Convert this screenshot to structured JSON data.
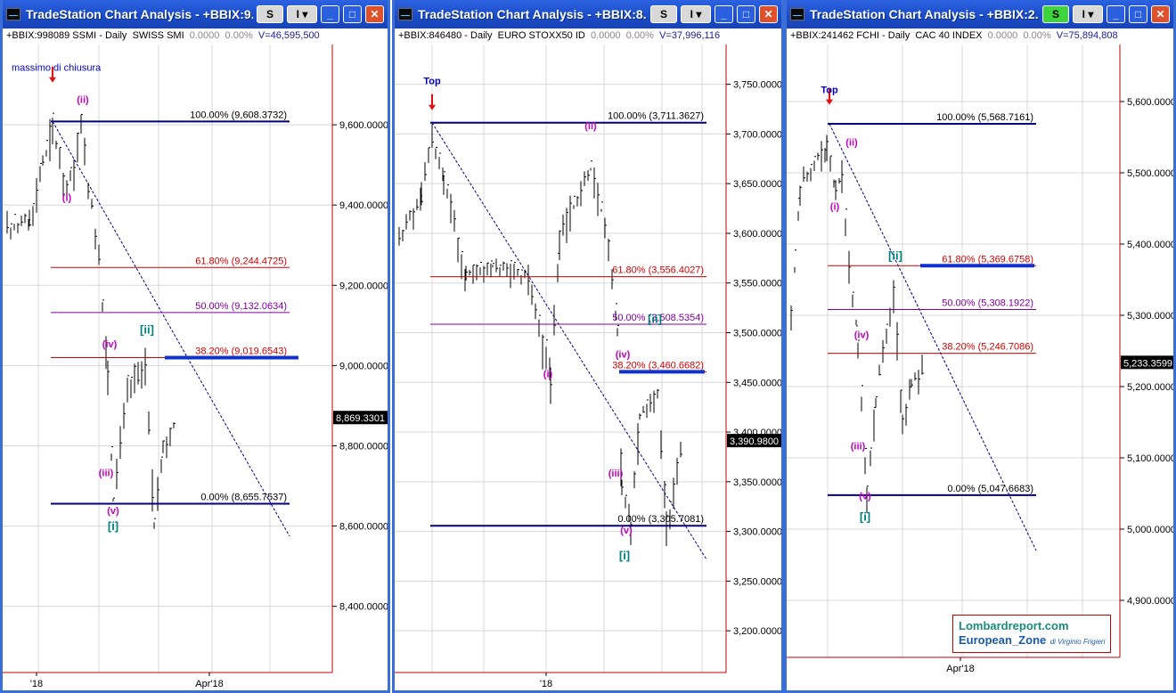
{
  "windows": [
    {
      "title": "TradeStation Chart Analysis - +BBIX:9...",
      "info": {
        "symbol": "+BBIX:998089 SSMI - Daily",
        "name": "SWISS SMI",
        "change": "0.0000",
        "pct": "0.00%",
        "volume": "V=46,595,500"
      },
      "s_label": "S",
      "controls": {
        "mode": "I",
        "minimize": "_",
        "maximize": "□",
        "close": "✕"
      }
    },
    {
      "title": "TradeStation Chart Analysis - +BBIX:8...",
      "info": {
        "symbol": "+BBIX:846480 - Daily",
        "name": "EURO STOXX50 ID",
        "change": "0.0000",
        "pct": "0.00%",
        "volume": "V=37,996,116"
      },
      "s_label": "S",
      "controls": {
        "mode": "I",
        "minimize": "_",
        "maximize": "□",
        "close": "✕"
      }
    },
    {
      "title": "TradeStation Chart Analysis - +BBIX:2...",
      "info": {
        "symbol": "+BBIX:241462 FCHI - Daily",
        "name": "CAC 40 INDEX",
        "change": "0.0000",
        "pct": "0.00%",
        "volume": "V=75,894,808"
      },
      "s_label": "S",
      "controls": {
        "mode": "I",
        "minimize": "_",
        "maximize": "□",
        "close": "✕"
      }
    }
  ],
  "chart_data": [
    {
      "type": "ohlc-bar",
      "yticks": [
        "8,400.0000",
        "8,600.0000",
        "8,800.0000",
        "9,000.0000",
        "9,200.0000",
        "9,400.0000",
        "9,600.0000"
      ],
      "ylim": [
        8235,
        9800
      ],
      "xticks": [
        "'18",
        "Apr'18"
      ],
      "last_price": "8,869.3301",
      "fib_levels": [
        {
          "label": "100.00% (9,608.3732)",
          "value": 9608.3732,
          "color": "#000080",
          "thick": true
        },
        {
          "label": "61.80% (9,244.4725)",
          "value": 9244.4725,
          "color": "#d00000"
        },
        {
          "label": "50.00% (9,132.0634)",
          "value": 9132.0634,
          "color": "#8000a0"
        },
        {
          "label": "38.20% (9,019.6543)",
          "value": 9019.6543,
          "color": "#d00000"
        },
        {
          "label": "0.00% (8,655.7537)",
          "value": 8655.7537,
          "color": "#000080",
          "thick": true
        }
      ],
      "annotations": [
        {
          "text": "massimo di chiusura",
          "color": "#0000c0"
        },
        {
          "text": "(ii)",
          "color": "#c000c0"
        },
        {
          "text": "(i)",
          "color": "#c000c0"
        },
        {
          "text": "[ii]",
          "color": "#008080"
        },
        {
          "text": "(iv)",
          "color": "#c000c0"
        },
        {
          "text": "(iii)",
          "color": "#c000c0"
        },
        {
          "text": "(v)",
          "color": "#c000c0"
        },
        {
          "text": "[i]",
          "color": "#008080"
        }
      ]
    },
    {
      "type": "ohlc-bar",
      "yticks": [
        "3,200.0000",
        "3,250.0000",
        "3,300.0000",
        "3,350.0000",
        "3,400.0000",
        "3,450.0000",
        "3,500.0000",
        "3,550.0000",
        "3,600.0000",
        "3,650.0000",
        "3,700.0000",
        "3,750.0000"
      ],
      "ylim": [
        3158,
        3790
      ],
      "xticks": [
        "'18"
      ],
      "last_price": "3,390.9800",
      "fib_levels": [
        {
          "label": "100.00% (3,711.3627)",
          "value": 3711.3627,
          "color": "#000080",
          "thick": true
        },
        {
          "label": "61.80% (3,556.4027)",
          "value": 3556.4027,
          "color": "#d00000"
        },
        {
          "label": "50.00% (3,508.5354)",
          "value": 3508.5354,
          "color": "#8000a0"
        },
        {
          "label": "38.20% (3,460.6682)",
          "value": 3460.6682,
          "color": "#d00000"
        },
        {
          "label": "0.00% (3,305.7081)",
          "value": 3305.7081,
          "color": "#000080",
          "thick": true
        }
      ],
      "annotations": [
        {
          "text": "Top",
          "color": "#0000c0"
        },
        {
          "text": "(ii)",
          "color": "#c000c0"
        },
        {
          "text": "(i)",
          "color": "#c000c0"
        },
        {
          "text": "(iv)",
          "color": "#c000c0"
        },
        {
          "text": "[ii]",
          "color": "#008080"
        },
        {
          "text": "(iii)",
          "color": "#c000c0"
        },
        {
          "text": "(v)",
          "color": "#c000c0"
        },
        {
          "text": "[i]",
          "color": "#008080"
        }
      ]
    },
    {
      "type": "ohlc-bar",
      "yticks": [
        "4,900.0000",
        "5,000.0000",
        "5,100.0000",
        "5,200.0000",
        "5,300.0000",
        "5,400.0000",
        "5,500.0000",
        "5,600.0000"
      ],
      "ylim": [
        4820,
        5680
      ],
      "xticks": [
        "Apr'18"
      ],
      "last_price": "5,233.3599",
      "fib_levels": [
        {
          "label": "100.00% (5,568.7161)",
          "value": 5568.7161,
          "color": "#000080",
          "thick": true
        },
        {
          "label": "61.80% (5,369.6758)",
          "value": 5369.6758,
          "color": "#d00000"
        },
        {
          "label": "50.00% (5,308.1922)",
          "value": 5308.1922,
          "color": "#8000a0"
        },
        {
          "label": "38.20% (5,246.7086)",
          "value": 5246.7086,
          "color": "#d00000"
        },
        {
          "label": "0.00% (5,047.6683)",
          "value": 5047.6683,
          "color": "#000080",
          "thick": true
        }
      ],
      "annotations": [
        {
          "text": "Top",
          "color": "#0000c0"
        },
        {
          "text": "(ii)",
          "color": "#c000c0"
        },
        {
          "text": "(i)",
          "color": "#c000c0"
        },
        {
          "text": "[ii]",
          "color": "#008080"
        },
        {
          "text": "(iv)",
          "color": "#c000c0"
        },
        {
          "text": "(iii)",
          "color": "#c000c0"
        },
        {
          "text": "(v)",
          "color": "#c000c0"
        },
        {
          "text": "[i]",
          "color": "#008080"
        }
      ]
    }
  ],
  "watermark": {
    "site": "Lombardreport.com",
    "zone": "European_Zone",
    "author": "di Virginio Frigieri"
  }
}
